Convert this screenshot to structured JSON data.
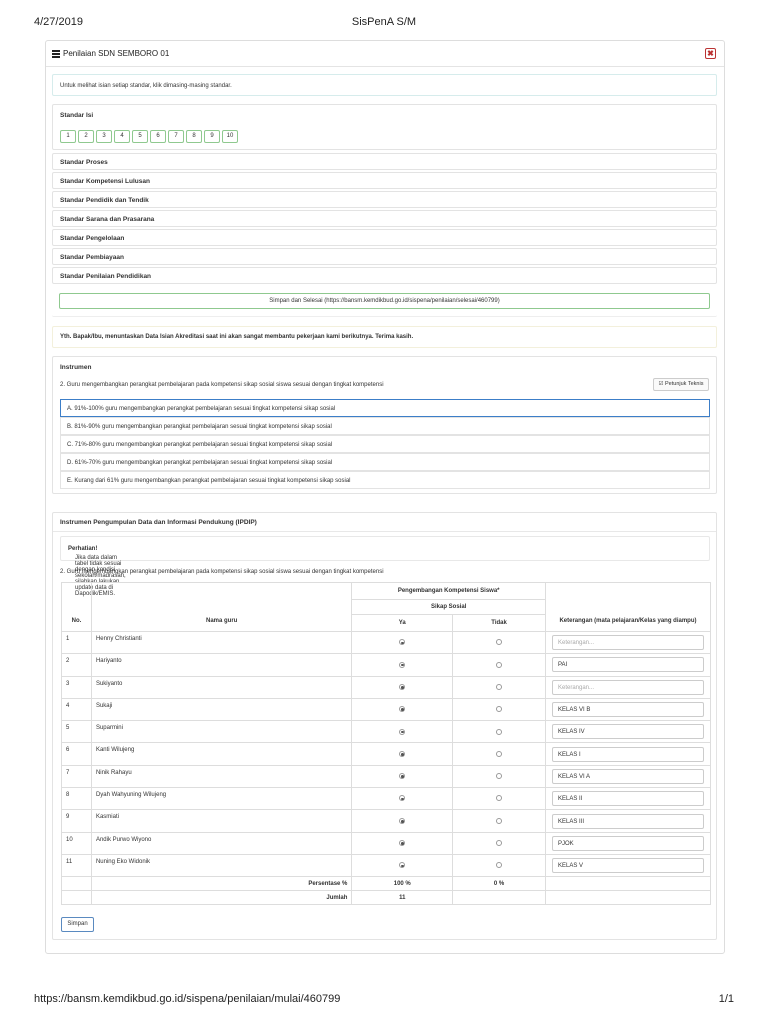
{
  "print_header": {
    "date": "4/27/2019",
    "title": "SisPenA S/M"
  },
  "print_footer": {
    "url": "https://bansm.kemdikbud.go.id/sispena/penilaian/mulai/460799",
    "page": "1/1"
  },
  "panel": {
    "title": "Penilaian SDN SEMBORO 01",
    "close_glyph": "✖"
  },
  "info_text": "Untuk melihat isian setiap standar, klik dimasing-masing standar.",
  "standar_isi": {
    "label": "Standar Isi",
    "numbers": [
      "1",
      "2",
      "3",
      "4",
      "5",
      "6",
      "7",
      "8",
      "9",
      "10"
    ]
  },
  "standards": [
    "Standar Proses",
    "Standar Kompetensi Lulusan",
    "Standar Pendidik dan Tendik",
    "Standar Sarana dan Prasarana",
    "Standar Pengelolaan",
    "Standar Pembiayaan",
    "Standar Penilaian Pendidikan"
  ],
  "save_finish_link": "Simpan dan Selesai (https://bansm.kemdikbud.go.id/sispena/penilaian/selesai/460799)",
  "thanks_text": "Yth. Bapak/Ibu, menuntaskan Data Isian Akreditasi saat ini akan sangat membantu pekerjaan kami berikutnya. Terima kasih.",
  "instrumen": {
    "heading": "Instrumen",
    "question": "2. Guru mengembangkan perangkat pembelajaran pada kompetensi sikap sosial siswa sesuai dengan tingkat kompetensi",
    "tech_button": "Petunjuk Teknis",
    "options": [
      "A. 91%-100% guru mengembangkan perangkat pembelajaran sesuai tingkat kompetensi sikap sosial",
      "B. 81%-90% guru mengembangkan perangkat pembelajaran sesuai tingkat kompetensi sikap sosial",
      "C. 71%-80% guru mengembangkan perangkat pembelajaran sesuai tingkat kompetensi sikap sosial",
      "D. 61%-70% guru mengembangkan perangkat pembelajaran sesuai tingkat kompetensi sikap sosial",
      "E. Kurang dari 61% guru mengembangkan perangkat pembelajaran sesuai tingkat kompetensi sikap sosial"
    ],
    "selected_option": "A"
  },
  "ipdip": {
    "heading": "Instrumen Pengumpulan Data dan Informasi Pendukung (IPDIP)",
    "warning_bold": "Perhatian!",
    "warning_text": " Jika data dalam tabel tidak sesuai dengan kondisi sekolah/madrasah, silahkan lakukan update data di Dapodik/EMIS.",
    "question": "2. Guru mengembangkan perangkat pembelajaran pada kompetensi sikap sosial siswa sesuai dengan tingkat kompetensi",
    "table": {
      "header_group": "Pengembangan Kompetensi Siswa*",
      "header_sub": "Sikap Sosial",
      "col_no": "No.",
      "col_name": "Nama guru",
      "col_ya": "Ya",
      "col_tidak": "Tidak",
      "col_ket": "Keterangan (mata pelajaran/Kelas yang diampu)",
      "ket_placeholder": "Keterangan...",
      "rows": [
        {
          "no": "1",
          "name": "Henny Christianti",
          "ya": true,
          "ket": ""
        },
        {
          "no": "2",
          "name": "Hariyanto",
          "ya": true,
          "ket": "PAI"
        },
        {
          "no": "3",
          "name": "Sukiyanto",
          "ya": true,
          "ket": ""
        },
        {
          "no": "4",
          "name": "Sukaji",
          "ya": true,
          "ket": "KELAS VI B"
        },
        {
          "no": "5",
          "name": "Suparmini",
          "ya": true,
          "ket": "KELAS IV"
        },
        {
          "no": "6",
          "name": "Kanti Wilujeng",
          "ya": true,
          "ket": "KELAS I"
        },
        {
          "no": "7",
          "name": "Ninik Rahayu",
          "ya": true,
          "ket": "KELAS VI A"
        },
        {
          "no": "8",
          "name": "Dyah Wahyuning Wilujeng",
          "ya": true,
          "ket": "KELAS II"
        },
        {
          "no": "9",
          "name": "Kasmiati",
          "ya": true,
          "ket": "KELAS III"
        },
        {
          "no": "10",
          "name": "Andik Purwo Wiyono",
          "ya": true,
          "ket": "PJOK"
        },
        {
          "no": "11",
          "name": "Nuning Eko Widonik",
          "ya": true,
          "ket": "KELAS V"
        }
      ],
      "pct_label": "Persentase %",
      "pct_ya": "100 %",
      "pct_tidak": "0 %",
      "total_label": "Jumlah",
      "total_ya": "11"
    },
    "save_button": "Simpan"
  }
}
